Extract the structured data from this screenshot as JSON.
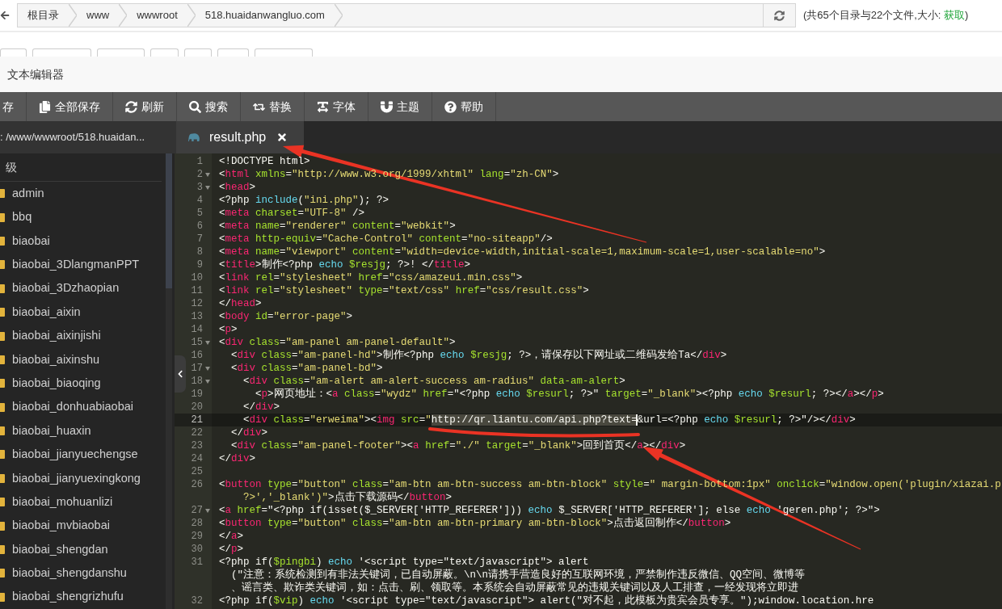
{
  "address_bar": {
    "crumbs": [
      "根目录",
      "www",
      "wwwroot",
      "518.huaidanwangluo.com"
    ],
    "summary": "(共65个目录与22个文件,大小: ",
    "summary_link": "获取",
    "summary_end": ")"
  },
  "page_toolbar": [
    {
      "kind": "button"
    },
    {
      "kind": "button"
    },
    {
      "kind": "button"
    },
    {
      "kind": "button"
    },
    {
      "kind": "button"
    },
    {
      "kind": "button"
    },
    {
      "kind": "button"
    }
  ],
  "dialog": {
    "title": "文本编辑器"
  },
  "toolbar": [
    {
      "kind": "save",
      "label": "存"
    },
    {
      "kind": "save_all",
      "label": "全部保存"
    },
    {
      "kind": "refresh",
      "label": "刷新"
    },
    {
      "kind": "search",
      "label": "搜索"
    },
    {
      "kind": "replace",
      "label": "替换"
    },
    {
      "kind": "font",
      "label": "字体"
    },
    {
      "kind": "theme",
      "label": "主题"
    },
    {
      "kind": "help",
      "label": "帮助"
    }
  ],
  "path": ": /www/wwwroot/518.huaidan...",
  "tabs": [
    {
      "label": "result.php",
      "selected": true
    }
  ],
  "sidebar": {
    "parent_label": "级",
    "folders": [
      "admin",
      "bbq",
      "biaobai",
      "biaobai_3DlangmanPPT",
      "biaobai_3Dzhaopian",
      "biaobai_aixin",
      "biaobai_aixinjishi",
      "biaobai_aixinshu",
      "biaobai_biaoqing",
      "biaobai_donhuabiaobai",
      "biaobai_huaxin",
      "biaobai_jianyuechengse",
      "biaobai_jianyuexingkong",
      "biaobai_mohuanlizi",
      "biaobai_mvbiaobai",
      "biaobai_shengdan",
      "biaobai_shengdanshu",
      "biaobai_shengrizhufu"
    ]
  },
  "editor": {
    "rows": [
      {
        "kind": "line",
        "number": "1",
        "foldable": false,
        "active": false,
        "tokens": [
          {
            "kind": "plain",
            "text": "<!DOCTYPE html>"
          }
        ]
      },
      {
        "kind": "line",
        "number": "2",
        "foldable": true,
        "active": false,
        "tokens": [
          {
            "kind": "plain",
            "text": "<"
          },
          {
            "kind": "tag",
            "text": "html"
          },
          {
            "kind": "attr",
            "text": " xmlns"
          },
          {
            "kind": "plain",
            "text": "="
          },
          {
            "kind": "string",
            "text": "\"http://www.w3.org/1999/xhtml\""
          },
          {
            "kind": "attr",
            "text": " lang"
          },
          {
            "kind": "plain",
            "text": "="
          },
          {
            "kind": "string",
            "text": "\"zh-CN\""
          },
          {
            "kind": "plain",
            "text": ">"
          }
        ]
      },
      {
        "kind": "line",
        "number": "3",
        "foldable": true,
        "active": false,
        "tokens": [
          {
            "kind": "plain",
            "text": "<"
          },
          {
            "kind": "tag",
            "text": "head"
          },
          {
            "kind": "plain",
            "text": ">"
          }
        ]
      },
      {
        "kind": "line",
        "number": "4",
        "foldable": false,
        "active": false,
        "tokens": [
          {
            "kind": "plain",
            "text": "<?php "
          },
          {
            "kind": "keyword",
            "text": "include"
          },
          {
            "kind": "plain",
            "text": "("
          },
          {
            "kind": "string",
            "text": "\"ini.php\""
          },
          {
            "kind": "plain",
            "text": "); ?>"
          }
        ]
      },
      {
        "kind": "line",
        "number": "5",
        "foldable": false,
        "active": false,
        "tokens": [
          {
            "kind": "plain",
            "text": "<"
          },
          {
            "kind": "tag",
            "text": "meta"
          },
          {
            "kind": "attr",
            "text": " charset"
          },
          {
            "kind": "plain",
            "text": "="
          },
          {
            "kind": "string",
            "text": "\"UTF-8\""
          },
          {
            "kind": "plain",
            "text": " />"
          }
        ]
      },
      {
        "kind": "line",
        "number": "6",
        "foldable": false,
        "active": false,
        "tokens": [
          {
            "kind": "plain",
            "text": "<"
          },
          {
            "kind": "tag",
            "text": "meta"
          },
          {
            "kind": "attr",
            "text": " name"
          },
          {
            "kind": "plain",
            "text": "="
          },
          {
            "kind": "string",
            "text": "\"renderer\""
          },
          {
            "kind": "attr",
            "text": " content"
          },
          {
            "kind": "plain",
            "text": "="
          },
          {
            "kind": "string",
            "text": "\"webkit\""
          },
          {
            "kind": "plain",
            "text": ">"
          }
        ]
      },
      {
        "kind": "line",
        "number": "7",
        "foldable": false,
        "active": false,
        "tokens": [
          {
            "kind": "plain",
            "text": "<"
          },
          {
            "kind": "tag",
            "text": "meta"
          },
          {
            "kind": "attr",
            "text": " http-equiv"
          },
          {
            "kind": "plain",
            "text": "="
          },
          {
            "kind": "string",
            "text": "\"Cache-Control\""
          },
          {
            "kind": "attr",
            "text": " content"
          },
          {
            "kind": "plain",
            "text": "="
          },
          {
            "kind": "string",
            "text": "\"no-siteapp\""
          },
          {
            "kind": "plain",
            "text": "/>"
          }
        ]
      },
      {
        "kind": "line",
        "number": "8",
        "foldable": false,
        "active": false,
        "tokens": [
          {
            "kind": "plain",
            "text": "<"
          },
          {
            "kind": "tag",
            "text": "meta"
          },
          {
            "kind": "attr",
            "text": " name"
          },
          {
            "kind": "plain",
            "text": "="
          },
          {
            "kind": "string",
            "text": "\"viewport\""
          },
          {
            "kind": "attr",
            "text": " content"
          },
          {
            "kind": "plain",
            "text": "="
          },
          {
            "kind": "string",
            "text": "\"width=device-width,initial-scale=1,maximum-scale=1,user-scalable=no\""
          },
          {
            "kind": "plain",
            "text": ">"
          }
        ]
      },
      {
        "kind": "line",
        "number": "9",
        "foldable": false,
        "active": false,
        "tokens": [
          {
            "kind": "plain",
            "text": "<"
          },
          {
            "kind": "tag",
            "text": "title"
          },
          {
            "kind": "plain",
            "text": ">制作<?php "
          },
          {
            "kind": "keyword",
            "text": "echo"
          },
          {
            "kind": "variable",
            "text": " $resjg"
          },
          {
            "kind": "plain",
            "text": "; ?>! </"
          },
          {
            "kind": "tag",
            "text": "title"
          },
          {
            "kind": "plain",
            "text": ">"
          }
        ]
      },
      {
        "kind": "line",
        "number": "10",
        "foldable": false,
        "active": false,
        "tokens": [
          {
            "kind": "plain",
            "text": "<"
          },
          {
            "kind": "tag",
            "text": "link"
          },
          {
            "kind": "attr",
            "text": " rel"
          },
          {
            "kind": "plain",
            "text": "="
          },
          {
            "kind": "string",
            "text": "\"stylesheet\""
          },
          {
            "kind": "attr",
            "text": " href"
          },
          {
            "kind": "plain",
            "text": "="
          },
          {
            "kind": "string",
            "text": "\"css/amazeui.min.css\""
          },
          {
            "kind": "plain",
            "text": ">"
          }
        ]
      },
      {
        "kind": "line",
        "number": "11",
        "foldable": false,
        "active": false,
        "tokens": [
          {
            "kind": "plain",
            "text": "<"
          },
          {
            "kind": "tag",
            "text": "link"
          },
          {
            "kind": "attr",
            "text": " rel"
          },
          {
            "kind": "plain",
            "text": "="
          },
          {
            "kind": "string",
            "text": "\"stylesheet\""
          },
          {
            "kind": "attr",
            "text": " type"
          },
          {
            "kind": "plain",
            "text": "="
          },
          {
            "kind": "string",
            "text": "\"text/css\""
          },
          {
            "kind": "attr",
            "text": " href"
          },
          {
            "kind": "plain",
            "text": "="
          },
          {
            "kind": "string",
            "text": "\"css/result.css\""
          },
          {
            "kind": "plain",
            "text": ">"
          }
        ]
      },
      {
        "kind": "line",
        "number": "12",
        "foldable": false,
        "active": false,
        "tokens": [
          {
            "kind": "plain",
            "text": "</"
          },
          {
            "kind": "tag",
            "text": "head"
          },
          {
            "kind": "plain",
            "text": ">"
          }
        ]
      },
      {
        "kind": "line",
        "number": "13",
        "foldable": false,
        "active": false,
        "tokens": [
          {
            "kind": "plain",
            "text": "<"
          },
          {
            "kind": "tag",
            "text": "body"
          },
          {
            "kind": "attr",
            "text": " id"
          },
          {
            "kind": "plain",
            "text": "="
          },
          {
            "kind": "string",
            "text": "\"error-page\""
          },
          {
            "kind": "plain",
            "text": ">"
          }
        ]
      },
      {
        "kind": "line",
        "number": "14",
        "foldable": false,
        "active": false,
        "tokens": [
          {
            "kind": "plain",
            "text": "<"
          },
          {
            "kind": "tag",
            "text": "p"
          },
          {
            "kind": "plain",
            "text": ">"
          }
        ]
      },
      {
        "kind": "line",
        "number": "15",
        "foldable": true,
        "active": false,
        "tokens": [
          {
            "kind": "plain",
            "text": "<"
          },
          {
            "kind": "tag",
            "text": "div"
          },
          {
            "kind": "attr",
            "text": " class"
          },
          {
            "kind": "plain",
            "text": "="
          },
          {
            "kind": "string",
            "text": "\"am-panel am-panel-default\""
          },
          {
            "kind": "plain",
            "text": ">"
          }
        ]
      },
      {
        "kind": "line",
        "number": "16",
        "foldable": false,
        "active": false,
        "tokens": [
          {
            "kind": "plain",
            "text": "  <"
          },
          {
            "kind": "tag",
            "text": "div"
          },
          {
            "kind": "attr",
            "text": " class"
          },
          {
            "kind": "plain",
            "text": "="
          },
          {
            "kind": "string",
            "text": "\"am-panel-hd\""
          },
          {
            "kind": "plain",
            "text": ">制作<?php "
          },
          {
            "kind": "keyword",
            "text": "echo"
          },
          {
            "kind": "variable",
            "text": " $resjg"
          },
          {
            "kind": "plain",
            "text": "; ?>，请保存以下网址或二维码发给Ta</"
          },
          {
            "kind": "tag",
            "text": "div"
          },
          {
            "kind": "plain",
            "text": ">"
          }
        ]
      },
      {
        "kind": "line",
        "number": "17",
        "foldable": true,
        "active": false,
        "tokens": [
          {
            "kind": "plain",
            "text": "  <"
          },
          {
            "kind": "tag",
            "text": "div"
          },
          {
            "kind": "attr",
            "text": " class"
          },
          {
            "kind": "plain",
            "text": "="
          },
          {
            "kind": "string",
            "text": "\"am-panel-bd\""
          },
          {
            "kind": "plain",
            "text": ">"
          }
        ]
      },
      {
        "kind": "line",
        "number": "18",
        "foldable": true,
        "active": false,
        "tokens": [
          {
            "kind": "plain",
            "text": "    <"
          },
          {
            "kind": "tag",
            "text": "div"
          },
          {
            "kind": "attr",
            "text": " class"
          },
          {
            "kind": "plain",
            "text": "="
          },
          {
            "kind": "string",
            "text": "\"am-alert am-alert-success am-radius\""
          },
          {
            "kind": "attr",
            "text": " data-am-alert"
          },
          {
            "kind": "plain",
            "text": ">"
          }
        ]
      },
      {
        "kind": "line",
        "number": "19",
        "foldable": false,
        "active": false,
        "tokens": [
          {
            "kind": "plain",
            "text": "      <"
          },
          {
            "kind": "tag",
            "text": "p"
          },
          {
            "kind": "plain",
            "text": ">网页地址：<"
          },
          {
            "kind": "tag",
            "text": "a"
          },
          {
            "kind": "attr",
            "text": " class"
          },
          {
            "kind": "plain",
            "text": "="
          },
          {
            "kind": "string",
            "text": "\"wydz\""
          },
          {
            "kind": "attr",
            "text": " href"
          },
          {
            "kind": "plain",
            "text": "=\"<?php "
          },
          {
            "kind": "keyword",
            "text": "echo"
          },
          {
            "kind": "variable",
            "text": " $resurl"
          },
          {
            "kind": "plain",
            "text": "; ?>\""
          },
          {
            "kind": "attr",
            "text": " target"
          },
          {
            "kind": "plain",
            "text": "="
          },
          {
            "kind": "string",
            "text": "\"_blank\""
          },
          {
            "kind": "plain",
            "text": "><?php "
          },
          {
            "kind": "keyword",
            "text": "echo"
          },
          {
            "kind": "variable",
            "text": " $resurl"
          },
          {
            "kind": "plain",
            "text": "; ?></"
          },
          {
            "kind": "tag",
            "text": "a"
          },
          {
            "kind": "plain",
            "text": "></"
          },
          {
            "kind": "tag",
            "text": "p"
          },
          {
            "kind": "plain",
            "text": ">"
          }
        ]
      },
      {
        "kind": "line",
        "number": "20",
        "foldable": false,
        "active": false,
        "tokens": [
          {
            "kind": "plain",
            "text": "    </"
          },
          {
            "kind": "tag",
            "text": "div"
          },
          {
            "kind": "plain",
            "text": ">"
          }
        ]
      },
      {
        "kind": "line",
        "number": "21",
        "foldable": false,
        "active": true,
        "tokens": [
          {
            "kind": "plain",
            "text": "    <"
          },
          {
            "kind": "tag",
            "text": "div"
          },
          {
            "kind": "attr",
            "text": " class"
          },
          {
            "kind": "plain",
            "text": "="
          },
          {
            "kind": "string",
            "text": "\"erweima\""
          },
          {
            "kind": "plain",
            "text": "><"
          },
          {
            "kind": "tag",
            "text": "img"
          },
          {
            "kind": "attr",
            "text": " src"
          },
          {
            "kind": "plain",
            "text": "="
          },
          {
            "kind": "string",
            "text": "\""
          },
          {
            "kind": "selection",
            "text": "http://qr.liantu.com/api.php?text="
          },
          {
            "kind": "plain",
            "text": "&url=<?php "
          },
          {
            "kind": "keyword",
            "text": "echo"
          },
          {
            "kind": "variable",
            "text": " $resurl"
          },
          {
            "kind": "plain",
            "text": "; ?>\"/></"
          },
          {
            "kind": "tag",
            "text": "div"
          },
          {
            "kind": "plain",
            "text": ">"
          }
        ]
      },
      {
        "kind": "line",
        "number": "22",
        "foldable": false,
        "active": false,
        "tokens": [
          {
            "kind": "plain",
            "text": "  </"
          },
          {
            "kind": "tag",
            "text": "div"
          },
          {
            "kind": "plain",
            "text": ">"
          }
        ]
      },
      {
        "kind": "line",
        "number": "23",
        "foldable": false,
        "active": false,
        "tokens": [
          {
            "kind": "plain",
            "text": "  <"
          },
          {
            "kind": "tag",
            "text": "div"
          },
          {
            "kind": "attr",
            "text": " class"
          },
          {
            "kind": "plain",
            "text": "="
          },
          {
            "kind": "string",
            "text": "\"am-panel-footer\""
          },
          {
            "kind": "plain",
            "text": "><"
          },
          {
            "kind": "tag",
            "text": "a"
          },
          {
            "kind": "attr",
            "text": " href"
          },
          {
            "kind": "plain",
            "text": "="
          },
          {
            "kind": "string",
            "text": "\"./\""
          },
          {
            "kind": "attr",
            "text": " target"
          },
          {
            "kind": "plain",
            "text": "="
          },
          {
            "kind": "string",
            "text": "\"_blank\""
          },
          {
            "kind": "plain",
            "text": ">回到首页</"
          },
          {
            "kind": "tag",
            "text": "a"
          },
          {
            "kind": "plain",
            "text": "></"
          },
          {
            "kind": "tag",
            "text": "div"
          },
          {
            "kind": "plain",
            "text": ">"
          }
        ]
      },
      {
        "kind": "line",
        "number": "24",
        "foldable": false,
        "active": false,
        "tokens": [
          {
            "kind": "plain",
            "text": "</"
          },
          {
            "kind": "tag",
            "text": "div"
          },
          {
            "kind": "plain",
            "text": ">"
          }
        ]
      },
      {
        "kind": "line",
        "number": "25",
        "foldable": false,
        "active": false
      },
      {
        "kind": "line",
        "number": "26",
        "foldable": false,
        "active": false,
        "tokens": [
          {
            "kind": "plain",
            "text": "<"
          },
          {
            "kind": "tag",
            "text": "button"
          },
          {
            "kind": "attr",
            "text": " type"
          },
          {
            "kind": "plain",
            "text": "="
          },
          {
            "kind": "string",
            "text": "\"button\""
          },
          {
            "kind": "attr",
            "text": " class"
          },
          {
            "kind": "plain",
            "text": "="
          },
          {
            "kind": "string",
            "text": "\"am-btn am-btn-success am-btn-block\""
          },
          {
            "kind": "attr",
            "text": " style"
          },
          {
            "kind": "plain",
            "text": "="
          },
          {
            "kind": "string",
            "text": "\" margin-bottom:1px\""
          },
          {
            "kind": "attr",
            "text": " onclick"
          },
          {
            "kind": "plain",
            "text": "="
          },
          {
            "kind": "string",
            "text": "\"window.open('plugin/xiazai.p"
          }
        ]
      },
      {
        "kind": "wrap",
        "tokens": [
          {
            "kind": "string",
            "text": "  ?>','_blank')\""
          },
          {
            "kind": "plain",
            "text": ">点击下载源码</"
          },
          {
            "kind": "tag",
            "text": "button"
          },
          {
            "kind": "plain",
            "text": ">"
          }
        ]
      },
      {
        "kind": "line",
        "number": "27",
        "foldable": true,
        "active": false,
        "tokens": [
          {
            "kind": "plain",
            "text": "<"
          },
          {
            "kind": "tag",
            "text": "a"
          },
          {
            "kind": "attr",
            "text": " href"
          },
          {
            "kind": "plain",
            "text": "=\"<?php if(isset($_SERVER['HTTP_REFERER'])) "
          },
          {
            "kind": "keyword",
            "text": "echo"
          },
          {
            "kind": "plain",
            "text": " $_SERVER['HTTP_REFERER']; else "
          },
          {
            "kind": "keyword",
            "text": "echo"
          },
          {
            "kind": "plain",
            "text": " 'geren.php'; ?>\">"
          }
        ]
      },
      {
        "kind": "line",
        "number": "28",
        "foldable": false,
        "active": false,
        "tokens": [
          {
            "kind": "plain",
            "text": "<"
          },
          {
            "kind": "tag",
            "text": "button"
          },
          {
            "kind": "attr",
            "text": " type"
          },
          {
            "kind": "plain",
            "text": "="
          },
          {
            "kind": "string",
            "text": "\"button\""
          },
          {
            "kind": "attr",
            "text": " class"
          },
          {
            "kind": "plain",
            "text": "="
          },
          {
            "kind": "string",
            "text": "\"am-btn am-btn-primary am-btn-block\""
          },
          {
            "kind": "plain",
            "text": ">点击返回制作</"
          },
          {
            "kind": "tag",
            "text": "button"
          },
          {
            "kind": "plain",
            "text": ">"
          }
        ]
      },
      {
        "kind": "line",
        "number": "29",
        "foldable": false,
        "active": false,
        "tokens": [
          {
            "kind": "plain",
            "text": "</"
          },
          {
            "kind": "tag",
            "text": "a"
          },
          {
            "kind": "plain",
            "text": ">"
          }
        ]
      },
      {
        "kind": "line",
        "number": "30",
        "foldable": false,
        "active": false,
        "tokens": [
          {
            "kind": "plain",
            "text": "</"
          },
          {
            "kind": "tag",
            "text": "p"
          },
          {
            "kind": "plain",
            "text": ">"
          }
        ]
      },
      {
        "kind": "line",
        "number": "31",
        "foldable": false,
        "active": false,
        "tokens": [
          {
            "kind": "plain",
            "text": "<?php if("
          },
          {
            "kind": "variable",
            "text": "$pingbi"
          },
          {
            "kind": "plain",
            "text": ") "
          },
          {
            "kind": "keyword",
            "text": "echo"
          },
          {
            "kind": "plain",
            "text": " '<script type=\"text/javascript\"> alert"
          }
        ]
      },
      {
        "kind": "wrap",
        "tokens": [
          {
            "kind": "plain",
            "text": "(\"注意：系统检测到有非法关键词，已自动屏蔽。\\n\\n请携手营造良好的互联网环境，严禁制作违反微信、QQ空间、微博等"
          }
        ]
      },
      {
        "kind": "wrap",
        "tokens": [
          {
            "kind": "plain",
            "text": "、谣言类、欺诈类关键词，如：点击、刷、领取等。本系统会自动屏蔽常见的违规关键词以及人工排查，一经发现将立即进"
          }
        ]
      },
      {
        "kind": "line",
        "number": "32",
        "foldable": false,
        "active": false,
        "tokens": [
          {
            "kind": "plain",
            "text": "<?php if("
          },
          {
            "kind": "variable",
            "text": "$vip"
          },
          {
            "kind": "plain",
            "text": ") "
          },
          {
            "kind": "keyword",
            "text": "echo"
          },
          {
            "kind": "plain",
            "text": " '<script type=\"text/javascript\"> alert(\"对不起，此模板为贵宾会员专享。\");window.location.hre"
          }
        ]
      }
    ]
  },
  "annotations": [
    {
      "kind": "arrow"
    },
    {
      "kind": "arrow"
    },
    {
      "kind": "underline"
    }
  ]
}
